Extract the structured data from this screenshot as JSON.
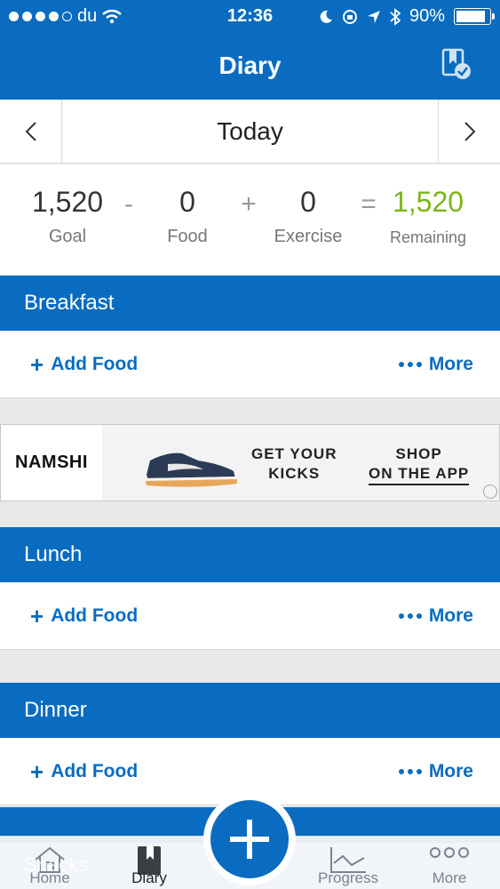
{
  "status_bar": {
    "carrier": "du",
    "time": "12:36",
    "battery": "90%",
    "battery_level": 0.9
  },
  "header": {
    "title": "Diary"
  },
  "date_nav": {
    "current": "Today"
  },
  "summary": {
    "goal_value": "1,520",
    "goal_label": "Goal",
    "op1": "-",
    "food_value": "0",
    "food_label": "Food",
    "op2": "+",
    "exercise_value": "0",
    "exercise_label": "Exercise",
    "op3": "=",
    "remaining_value": "1,520",
    "remaining_label": "Remaining",
    "remaining_color": "#7cb518"
  },
  "meals": [
    {
      "name": "Breakfast",
      "add_label": "Add Food",
      "more_label": "More"
    },
    {
      "name": "Lunch",
      "add_label": "Add Food",
      "more_label": "More"
    },
    {
      "name": "Dinner",
      "add_label": "Add Food",
      "more_label": "More"
    }
  ],
  "ad": {
    "brand": "NAMSHI",
    "tagline_line1": "GET YOUR",
    "tagline_line2": "KICKS",
    "cta_line1": "SHOP",
    "cta_line2": "ON THE APP"
  },
  "snacks_label": "Snacks",
  "tabbar": {
    "home": "Home",
    "diary": "Diary",
    "progress": "Progress",
    "more": "More"
  },
  "colors": {
    "brand_blue": "#0a6cc0",
    "green": "#7cb518"
  }
}
